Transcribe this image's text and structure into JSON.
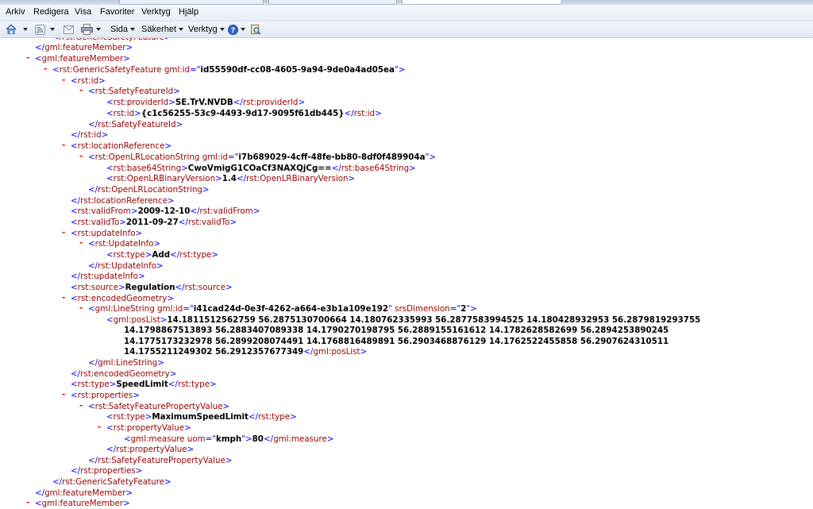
{
  "menu": [
    "Arkiv",
    "Redigera",
    "Visa",
    "Favoriter",
    "Verktyg",
    "Hjälp"
  ],
  "commandbar": {
    "page_label": "Sida",
    "safety_label": "Säkerhet",
    "tools_label": "Verktyg"
  },
  "xml": {
    "gsf_close_partial": "</rst:GenericSafetyFeature>",
    "fm_close": "</gml:featureMember>",
    "fm_open": "<gml:featureMember>",
    "gsf_tag": "rst:GenericSafetyFeature",
    "gsf_attr": "gml:id",
    "gsf_id": "id55590df-cc08-4605-9a94-9de0a4ad05ea",
    "provider_id": "SE.TrV.NVDB",
    "rst_id": "{c1c56255-53c9-4493-9d17-9095f61db445}",
    "olr_id": "i7b689029-4cff-48fe-bb80-8df0f489904a",
    "base64": "CwoVmigG1COaCf3NAXQjCg==",
    "olr_version": "1.4",
    "valid_from": "2009-12-10",
    "valid_to": "2011-09-27",
    "update_type": "Add",
    "source": "Regulation",
    "linestring_id": "i41cad24d-0e3f-4262-a664-e3b1a109e192",
    "srs_dimension": "2",
    "poslist": [
      "14.1811512562759 56.2875130700664 14.180762335993 56.2877583994525 14.180428932953 56.2879819293755",
      "14.1798867513893 56.2883407089338 14.1790270198795 56.2889155161612 14.1782628582699 56.2894253890245",
      "14.1775173232978 56.2899208074491 14.1768816489891 56.2903468876129 14.1762522455858 56.2907624310511",
      "14.1755211249302 56.2912357677349"
    ],
    "feature_type": "SpeedLimit",
    "property_type": "MaximumSpeedLimit",
    "uom": "kmph",
    "measure": "80"
  }
}
